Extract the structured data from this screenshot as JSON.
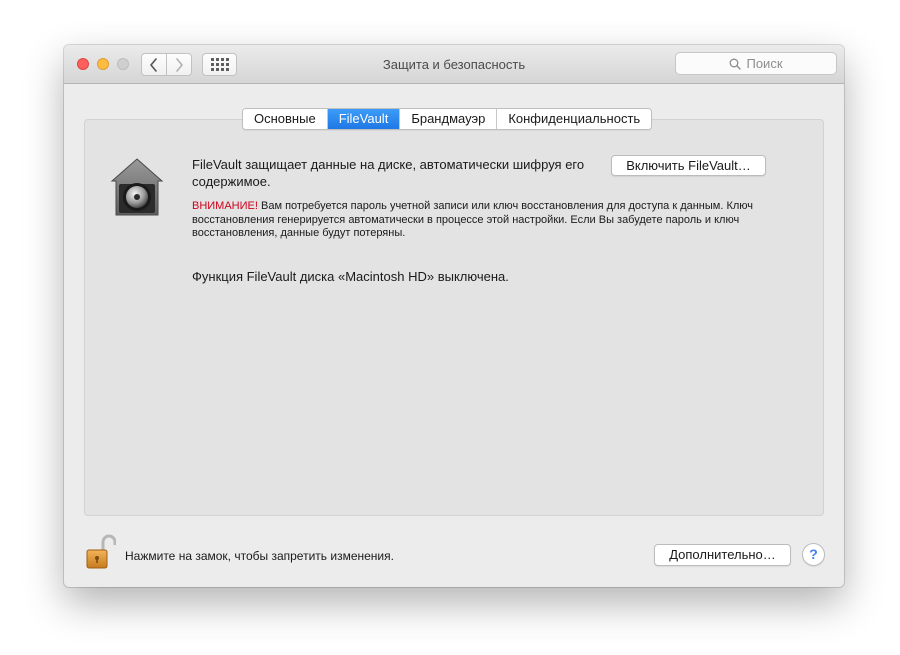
{
  "window": {
    "title": "Защита и безопасность",
    "search_placeholder": "Поиск"
  },
  "toolbar": {
    "back_icon": "chevron-left-icon",
    "forward_icon": "chevron-right-icon",
    "grid_icon": "grid-icon"
  },
  "tabs": [
    {
      "label": "Основные",
      "active": false
    },
    {
      "label": "FileVault",
      "active": true
    },
    {
      "label": "Брандмауэр",
      "active": false
    },
    {
      "label": "Конфиденциальность",
      "active": false
    }
  ],
  "filevault": {
    "description": "FileVault защищает данные на диске, автоматически шифруя его содержимое.",
    "enable_button": "Включить FileVault…",
    "warning_label": "ВНИМАНИЕ!",
    "warning_text": " Вам потребуется пароль учетной записи или ключ восстановления для доступа к данным. Ключ восстановления генерируется автоматически в процессе этой настройки. Если Вы забудете пароль и ключ восстановления, данные будут потеряны.",
    "status": "Функция FileVault диска «Macintosh HD» выключена."
  },
  "footer": {
    "lock_text": "Нажмите на замок, чтобы запретить изменения.",
    "advanced_button": "Дополнительно…",
    "help_button": "?"
  },
  "colors": {
    "accent": "#1e78e6",
    "warning": "#d0021b",
    "close": "#fc605c",
    "minimize": "#fdbc40"
  }
}
